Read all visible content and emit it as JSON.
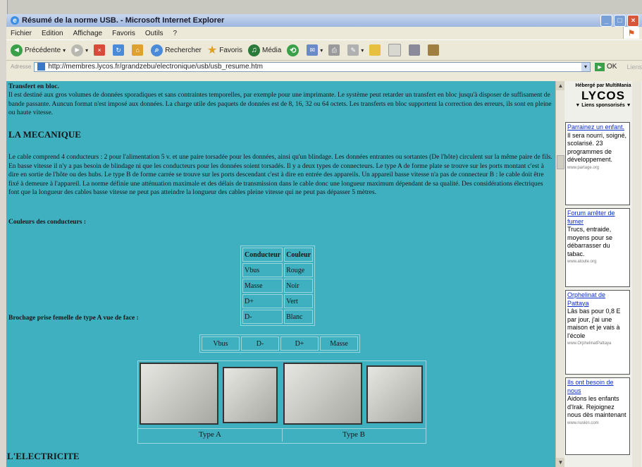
{
  "window": {
    "title": "Résumé de la norme USB. - Microsoft Internet Explorer"
  },
  "menu": [
    "Fichier",
    "Edition",
    "Affichage",
    "Favoris",
    "Outils",
    "?"
  ],
  "toolbar": {
    "back_label": "Précédente",
    "search_label": "Rechercher",
    "favorites_label": "Favoris",
    "media_label": "Média"
  },
  "address": {
    "label": "Adresse",
    "url": "http://membres.lycos.fr/grandzebu/electronique/usb/usb_resume.htm",
    "go_label": "OK",
    "links_label": "Liens"
  },
  "page": {
    "transfer_title": "Transfert en bloc.",
    "transfer_text": "Il est destiné aux gros volumes de données sporadiques et sans contraintes temporelles, par exemple pour une imprimante. Le système peut retarder un transfert en bloc jusqu'à disposer de suffisament de bande passante. Auncun format n'est imposé aux données. La charge utile des paquets de données est de 8, 16, 32 ou 64 octets. Les transferts en bloc supportent la correction des erreurs, ils sont en pleine ou haute vitesse.",
    "mecanique_title": "LA MECANIQUE",
    "mecanique_text": "Le cable comprend 4 conducteurs : 2 pour l'alimentation 5 v. et une paire torsadée pour les données, ainsi qu'un blindage. Les données entrantes ou sortantes (De l'hôte) circulent sur la même paire de fils. En basse vitesse il n'y a pas besoin de blindage ni que les conducteurs pour les données soient torsadés. Il y a deux types de connecteurs. Le type A de forme plate se trouve sur les ports montant c'est à dire en sortie de l'hôte ou des hubs. Le type B de forme carrée se trouve sur les ports descendant c'est à dire en entrée des appareils. Un appareil basse vitesse n'a pas de connecteur B : le cable doit être fixé à demeure à l'appareil. La norme définie une atténuation maximale et des délais de transmission dans le cable donc une longueur maximum dépendant de sa qualité. Des considérations électriques font que la longueur des cables basse vitesse ne peut pas atteindre la longueur des cables pleine vitesse qui ne peut pas dépasser 5 mètres.",
    "couleurs_title": "Couleurs des conducteurs :",
    "conducteurs": {
      "headers": [
        "Conducteur",
        "Couleur"
      ],
      "rows": [
        [
          "Vbus",
          "Rouge"
        ],
        [
          "Masse",
          "Noir"
        ],
        [
          "D+",
          "Vert"
        ],
        [
          "D-",
          "Blanc"
        ]
      ]
    },
    "brochage_title": "Brochage prise femelle de type A vue de face :",
    "brochage": [
      "Vbus",
      "D-",
      "D+",
      "Masse"
    ],
    "type_a": "Type A",
    "type_b": "Type B",
    "electricite_title": "L'ELECTRICITE"
  },
  "ads": {
    "host_label": "Hébergé par MultiMania",
    "brand": "LYCOS",
    "sponsored_label": "▼ Liens sponsorisés ▼",
    "items": [
      {
        "title": "Parrainez un enfant.",
        "text": "Il sera nourri, soigné, scolarisé. 23 programmes de développement.",
        "url": "www.partage.org"
      },
      {
        "title": "Forum arrêter de fumer",
        "text": "Trucs, entraide, moyens pour se débarrasser du tabac.",
        "url": "www.atoute.org"
      },
      {
        "title": "Orphelinat de Pattaya",
        "text": "Lâs bas pour 0,8 E par jour, j'ai une maison et je vais à l'école",
        "url": "www.OrphelinatPattaya"
      },
      {
        "title": "Ils ont besoin de nous",
        "text": "Aidons les enfants d'Irak. Rejoignez nous dès maintenant",
        "url": "www.nuskin.com"
      }
    ]
  }
}
